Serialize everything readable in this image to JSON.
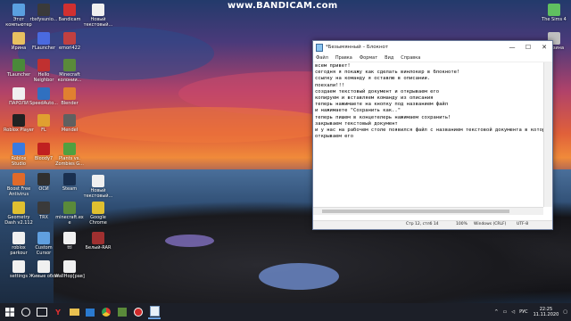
{
  "recorder": {
    "prefix": "www.",
    "brand": "BANDICAM",
    "suffix": ".com"
  },
  "desktop_icons": [
    {
      "label": "Этот компьютер",
      "color": "#5aa0e0"
    },
    {
      "label": "Ирина",
      "color": "#e8c060"
    },
    {
      "label": "TLauncher",
      "color": "#4a8a3a"
    },
    {
      "label": "ПАРОЛИ",
      "color": "#f0f0f0"
    },
    {
      "label": "Roblox Player",
      "color": "#222222"
    },
    {
      "label": "Roblox Studio",
      "color": "#3a7ae0"
    },
    {
      "label": "Boost Free Antivirus",
      "color": "#e06a2a"
    },
    {
      "label": "Geometry Dash v2.112",
      "color": "#e0c030"
    },
    {
      "label": "roblox parkour",
      "color": "#f0f0f0"
    },
    {
      "label": "settings",
      "color": "#f0f0f0"
    },
    {
      "label": "rbxfysunio...",
      "color": "#3a3a3a"
    },
    {
      "label": "FLauncher",
      "color": "#4a6ae0"
    },
    {
      "label": "Hello Neighbor",
      "color": "#c03030"
    },
    {
      "label": "SpeedAuto...",
      "color": "#3070c0"
    },
    {
      "label": "FL",
      "color": "#e0a030"
    },
    {
      "label": "Bloody7",
      "color": "#c02020"
    },
    {
      "label": "ОСИ",
      "color": "#303030"
    },
    {
      "label": "TRX",
      "color": "#3a3a3a"
    },
    {
      "label": "Custom Cursor",
      "color": "#60a0e0"
    },
    {
      "label": "Живые обои",
      "color": "#f0f0f0"
    },
    {
      "label": "Bandicam",
      "color": "#d03030"
    },
    {
      "label": "emori422",
      "color": "#c04040"
    },
    {
      "label": "Minecraft колонии...",
      "color": "#5a8a3a"
    },
    {
      "label": "Blender",
      "color": "#e08030"
    },
    {
      "label": "Mendel",
      "color": "#606060"
    },
    {
      "label": "Plants vs. Zombies G...",
      "color": "#50a040"
    },
    {
      "label": "Steam",
      "color": "#1a3050"
    },
    {
      "label": "minecraft.exe",
      "color": "#5a8a3a"
    },
    {
      "label": "ttl",
      "color": "#f0f0f0"
    },
    {
      "label": "WallHop[рав]",
      "color": "#f0f0f0"
    },
    {
      "label": "Новый текстовый...",
      "color": "#f0f0f0"
    },
    {
      "label": "Новый текстовый...",
      "color": "#f0f0f0"
    },
    {
      "label": "Google Chrome",
      "color": "#e0c030"
    },
    {
      "label": "Белый-RAR",
      "color": "#a03030"
    },
    {
      "label": "The Sims 4",
      "color": "#60c060"
    },
    {
      "label": "Корзина",
      "color": "#c0c0c0"
    }
  ],
  "notepad": {
    "title": "*Безымянный – Блокнот",
    "controls": {
      "minimize": "—",
      "maximize": "☐",
      "close": "✕"
    },
    "menu": [
      "Файл",
      "Правка",
      "Формат",
      "Вид",
      "Справка"
    ],
    "lines": [
      "всем привет!",
      "сегодня я покажу как сделать винлокер в блокноте!",
      "ссылку на команду я оставлю в описании.",
      "поехали!!!",
      "создаем текстовый документ и открываем его",
      "копируем и вставляем команду из описания",
      "теперь нажимаете на кнопку под названием файл",
      "и нажимаете \"Сохранить как..\"",
      "теперь пишем в концетелерь нажимаем сохранить!",
      "закрываем текстовый документ",
      "и у нас на рабочем столе появился файл с названием текстовой документа в котором",
      "открываем его"
    ],
    "status": {
      "position": "Стр 12, стлб 14",
      "zoom": "100%",
      "eol": "Windows (CRLF)",
      "encoding": "UTF-8"
    }
  },
  "taskbar": {
    "tray_lang": "РУС",
    "time": "22:25",
    "date": "11.11.2020"
  }
}
